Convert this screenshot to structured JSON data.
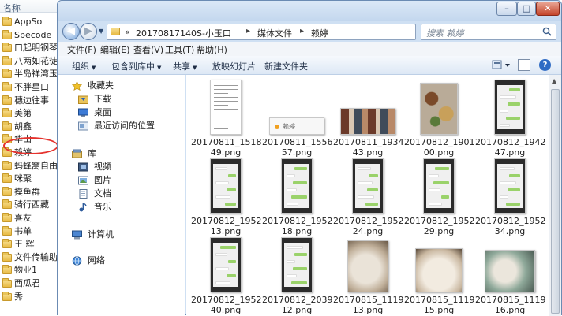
{
  "background_pane": {
    "header": "名称",
    "folders": [
      "AppSo",
      "Specode",
      "口起明钢琴",
      "八两如花徒",
      "半岛祥湾玉",
      "不胖星口",
      "穗边往事",
      "美第",
      "胡鑫",
      "华山",
      "赖婷",
      "蚂蜂窝自由",
      "咪聚",
      "摸鱼群",
      "骑行西藏",
      "喜友",
      "书单",
      "王 辉",
      "文件传输助",
      "物业1",
      "西瓜君",
      "秀"
    ],
    "highlighted_folder": "赖婷"
  },
  "window": {
    "caption_buttons": {
      "min": "–",
      "max": "□",
      "close": "✕"
    },
    "breadcrumb": [
      "«",
      "20170817140S-小玉口",
      "媒体文件",
      "赖婷"
    ],
    "search_placeholder": "搜索 赖婷",
    "menu": [
      "文件(F)",
      "编辑(E)",
      "查看(V)",
      "工具(T)",
      "帮助(H)"
    ],
    "toolbar": [
      "组织",
      "包含到库中",
      "共享",
      "放映幻灯片",
      "新建文件夹"
    ],
    "help_label": "?"
  },
  "nav_pane": {
    "favorites_title": "收藏夹",
    "favorites": [
      "下载",
      "桌面",
      "最近访问的位置"
    ],
    "library_title": "库",
    "libraries": [
      "视频",
      "图片",
      "文档",
      "音乐"
    ],
    "computer": "计算机",
    "network": "网络"
  },
  "files": [
    {
      "line1": "20170811_1518",
      "line2": "49.png",
      "kind": "doc"
    },
    {
      "line1": "20170811_1556",
      "line2": "57.png",
      "kind": "banner"
    },
    {
      "line1": "20170811_1934",
      "line2": "43.png",
      "kind": "strip"
    },
    {
      "line1": "20170812_1901",
      "line2": "00.png",
      "kind": "food"
    },
    {
      "line1": "20170812_1942",
      "line2": "47.png",
      "kind": "phone"
    },
    {
      "line1": "20170812_1952",
      "line2": "13.png",
      "kind": "phone"
    },
    {
      "line1": "20170812_1952",
      "line2": "18.png",
      "kind": "phone"
    },
    {
      "line1": "20170812_1952",
      "line2": "24.png",
      "kind": "phone"
    },
    {
      "line1": "20170812_1952",
      "line2": "29.png",
      "kind": "phone"
    },
    {
      "line1": "20170812_1952",
      "line2": "34.png",
      "kind": "phone"
    },
    {
      "line1": "20170812_1952",
      "line2": "40.png",
      "kind": "phone"
    },
    {
      "line1": "20170812_2039",
      "line2": "12.png",
      "kind": "phone"
    },
    {
      "line1": "20170815_1119",
      "line2": "13.png",
      "kind": "photo"
    },
    {
      "line1": "20170815_1119",
      "line2": "15.png",
      "kind": "photo"
    },
    {
      "line1": "20170815_1119",
      "line2": "16.png",
      "kind": "photo"
    }
  ],
  "banner_text": "赖婷"
}
